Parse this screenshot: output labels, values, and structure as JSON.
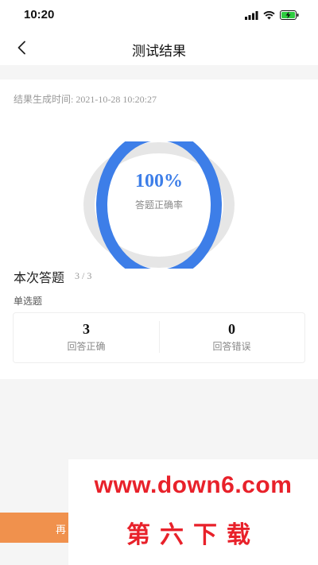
{
  "status": {
    "time": "10:20"
  },
  "nav": {
    "title": "测试结果"
  },
  "result": {
    "generated_label": "结果生成时间:",
    "generated_time": "2021-10-28 10:20:27",
    "rate_value": "100%",
    "rate_label": "答题正确率",
    "rate_fraction": 1.0,
    "ring_color": "#3d7ee8"
  },
  "answers": {
    "title": "本次答题",
    "count": "3 / 3",
    "type_label": "单选题",
    "correct_num": "3",
    "correct_label": "回答正确",
    "wrong_num": "0",
    "wrong_label": "回答错误"
  },
  "bottom": {
    "retry_label": "再"
  },
  "watermark": {
    "url": "www.down6.com",
    "cn": "第六下载",
    "color": "#e8212a"
  },
  "accent": {
    "orange": "#f0914d"
  }
}
